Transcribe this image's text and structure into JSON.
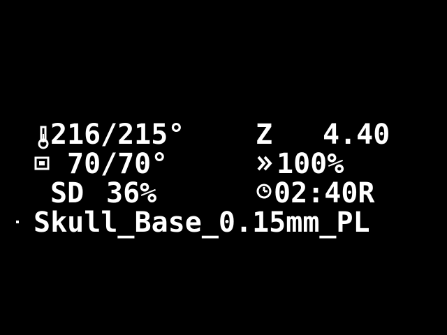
{
  "status_screen": {
    "hotend": {
      "icon": "thermometer-icon",
      "current": "216",
      "target": "/215°"
    },
    "bed": {
      "icon": "heated-bed-icon",
      "current": "70",
      "target": "/70°"
    },
    "z_position": {
      "label": "Z",
      "value": "4.40"
    },
    "feedrate": {
      "icon": "feedrate-icon",
      "value": "100%"
    },
    "sd_progress": {
      "label": "SD",
      "value": "36%"
    },
    "time_remaining": {
      "icon": "clock-icon",
      "value": "02:40R"
    },
    "filename": "Skull_Base_0.15mm_PL",
    "colors": {
      "foreground": "#ffffff",
      "background": "#000000"
    }
  }
}
